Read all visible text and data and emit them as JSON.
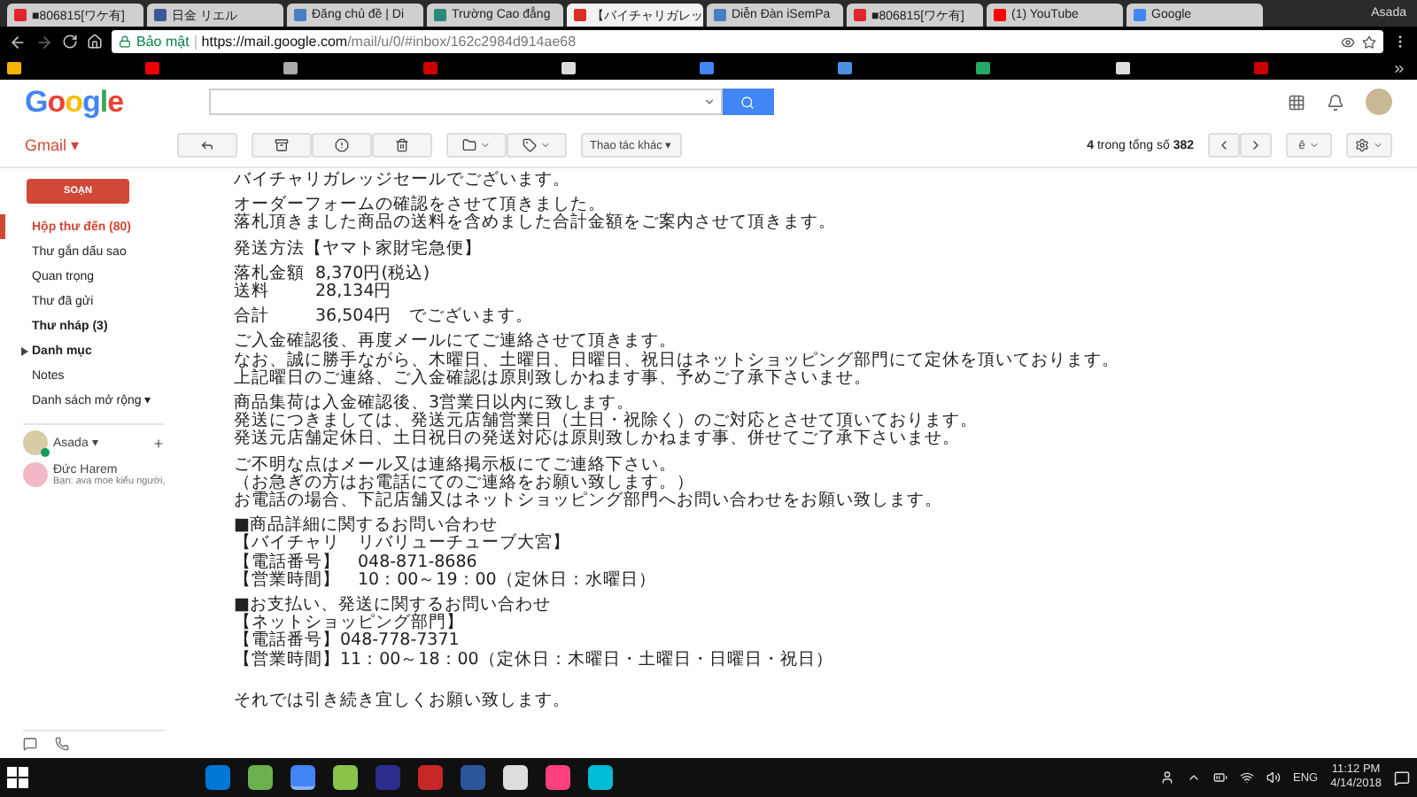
{
  "window": {
    "title": "Asada"
  },
  "tabs": [
    {
      "title": "■806815[ワケ有]",
      "selected": false,
      "color": "#e0252b"
    },
    {
      "title": "日金 リエル",
      "selected": false,
      "color": "#3b5998"
    },
    {
      "title": "Đăng chủ đề | Di",
      "selected": false,
      "color": "#4a7fc1"
    },
    {
      "title": "Trường Cao đẳng",
      "selected": false,
      "color": "#2a8a7a"
    },
    {
      "title": "【バイチャリガレッ",
      "selected": true,
      "color": "#d93025"
    },
    {
      "title": "Diễn Đàn iSemPa",
      "selected": false,
      "color": "#4a7fc1"
    },
    {
      "title": "■806815[ワケ有]",
      "selected": false,
      "color": "#e0252b"
    },
    {
      "title": "(1) YouTube",
      "selected": false,
      "color": "#ff0000"
    },
    {
      "title": "Google",
      "selected": false,
      "color": "#4285f4"
    }
  ],
  "address_bar": {
    "security": "Bảo mật",
    "url_host": "https://mail.google.com",
    "url_path": "/mail/u/0/#inbox/162c2984d914ae68"
  },
  "header": {
    "logo": [
      "G",
      "o",
      "o",
      "g",
      "l",
      "e"
    ]
  },
  "gmail": {
    "label": "Gmail ▾"
  },
  "toolbar": {
    "more_actions": "Thao tác khác ▾",
    "count_current": "4",
    "count_middle": " trong tổng số ",
    "count_total": "382",
    "language": "ê"
  },
  "sidebar": {
    "compose": "SOẠN",
    "items": [
      {
        "label": "Hộp thư đến (80)",
        "selected": true,
        "bold": true
      },
      {
        "label": "Thư gắn dấu sao",
        "selected": false,
        "bold": false
      },
      {
        "label": "Quan trọng",
        "selected": false,
        "bold": false
      },
      {
        "label": "Thư đã gửi",
        "selected": false,
        "bold": false
      },
      {
        "label": "Thư nháp (3)",
        "selected": false,
        "bold": true
      },
      {
        "label": "Danh mục",
        "selected": false,
        "bold": true,
        "expandable": true
      },
      {
        "label": "Notes",
        "selected": false,
        "bold": false
      },
      {
        "label": "Danh sách mở rộng ▾",
        "selected": false,
        "bold": false
      }
    ],
    "hangouts": {
      "user": "Asada ▾",
      "online": true,
      "contacts": [
        {
          "name": "Đức Harem",
          "snippet": "Bạn: ava moe kiểu người,"
        }
      ]
    }
  },
  "email": {
    "paragraphs": [
      {
        "kind": "text",
        "lines": [
          "バイチャリガレッジセールでございます。"
        ]
      },
      {
        "kind": "text",
        "lines": [
          "オーダーフォームの確認をさせて頂きました。",
          "落札頂きました商品の送料を含めました合計金額をご案内させて頂きます。"
        ]
      },
      {
        "kind": "text",
        "lines": [
          "発送方法【ヤマト家財宅急便】"
        ]
      },
      {
        "kind": "pairs",
        "lines": [
          {
            "label": "落札金額",
            "value": "8,370円(税込)"
          },
          {
            "label": "送料",
            "value": "28,134円"
          }
        ]
      },
      {
        "kind": "pairs",
        "lines": [
          {
            "label": "合計",
            "value": "36,504円　でございます。"
          }
        ]
      },
      {
        "kind": "text",
        "lines": [
          "ご入金確認後、再度メールにてご連絡させて頂きます。",
          "なお、誠に勝手ながら、木曜日、土曜日、日曜日、祝日はネットショッピング部門にて定休を頂いております。",
          "上記曜日のご連絡、ご入金確認は原則致しかねます事、予めご了承下さいませ。"
        ]
      },
      {
        "kind": "text",
        "lines": [
          "商品集荷は入金確認後、3営業日以内に致します。",
          "発送につきましては、発送元店舗営業日（土日・祝除く）のご対応とさせて頂いております。",
          "発送元店舗定休日、土日祝日の発送対応は原則致しかねます事、併せてご了承下さいませ。"
        ]
      },
      {
        "kind": "text",
        "lines": [
          "ご不明な点はメール又は連絡掲示板にてご連絡下さい。",
          "（お急ぎの方はお電話にてのご連絡をお願い致します。）",
          "お電話の場合、下記店舗又はネットショッピング部門へお問い合わせをお願い致します。"
        ]
      },
      {
        "kind": "text",
        "lines": [
          "■商品詳細に関するお問い合わせ",
          "【バイチャリ　リバリューチューブ大宮】",
          "【電話番号】　048-871-8686",
          "【営業時間】　10：00～19：00（定休日：水曜日）"
        ]
      },
      {
        "kind": "text",
        "lines": [
          "■お支払い、発送に関するお問い合わせ",
          "【ネットショッピング部門】",
          "【電話番号】048-778-7371",
          "【営業時間】11：00～18：00（定休日：木曜日・土曜日・日曜日・祝日）"
        ]
      },
      {
        "kind": "closing",
        "lines": [
          "それでは引き続き宜しくお願い致します。"
        ]
      }
    ]
  },
  "taskbar": {
    "language": "ENG",
    "time": "11:12 PM",
    "date": "4/14/2018",
    "apps": [
      {
        "color": "#0078d7",
        "selected": false
      },
      {
        "color": "#6ab04c",
        "selected": false
      },
      {
        "color": "#4285f4",
        "selected": true
      },
      {
        "color": "#8bc34a",
        "selected": false
      },
      {
        "color": "#2c2c8c",
        "selected": false
      },
      {
        "color": "#c62828",
        "selected": false
      },
      {
        "color": "#2b579a",
        "selected": false
      },
      {
        "color": "#dddddd",
        "selected": false
      },
      {
        "color": "#ff4081",
        "selected": false
      },
      {
        "color": "#00bcd4",
        "selected": false
      }
    ]
  }
}
